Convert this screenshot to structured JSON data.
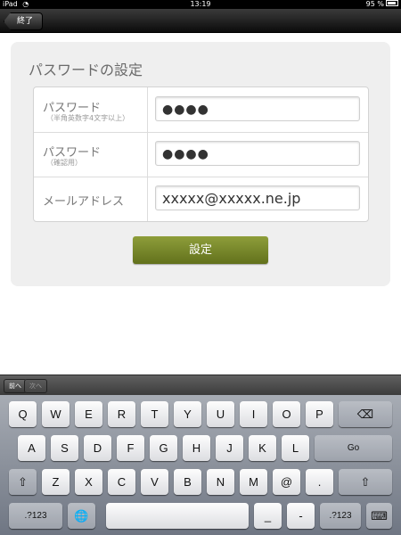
{
  "status_bar": {
    "device": "iPad",
    "time": "13:19",
    "battery": "95 %"
  },
  "nav": {
    "back_label": "終了"
  },
  "form": {
    "title": "パスワードの設定",
    "rows": [
      {
        "label": "パスワード",
        "sublabel": "（半角英数字4文字以上）",
        "value": "●●●●"
      },
      {
        "label": "パスワード",
        "sublabel": "（確認用）",
        "value": "●●●●"
      },
      {
        "label": "メールアドレス",
        "value": "xxxxx@xxxxx.ne.jp"
      }
    ],
    "submit_label": "設定"
  },
  "keyboard_toolbar": {
    "prev_label": "前へ",
    "next_label": "次へ"
  },
  "keyboard": {
    "row1": [
      "Q",
      "W",
      "E",
      "R",
      "T",
      "Y",
      "U",
      "I",
      "O",
      "P",
      "⌫"
    ],
    "row2": [
      "A",
      "S",
      "D",
      "F",
      "G",
      "H",
      "J",
      "K",
      "L",
      "Go"
    ],
    "row3": [
      "⇧",
      "Z",
      "X",
      "C",
      "V",
      "B",
      "N",
      "M",
      "@",
      ".",
      "⇧"
    ],
    "row4": [
      ".?123",
      "🌐",
      "",
      "_",
      "-",
      ".?123",
      "⌨"
    ]
  },
  "colors": {
    "accent_green": "#74842a",
    "navbar": "#1a1a1a"
  }
}
